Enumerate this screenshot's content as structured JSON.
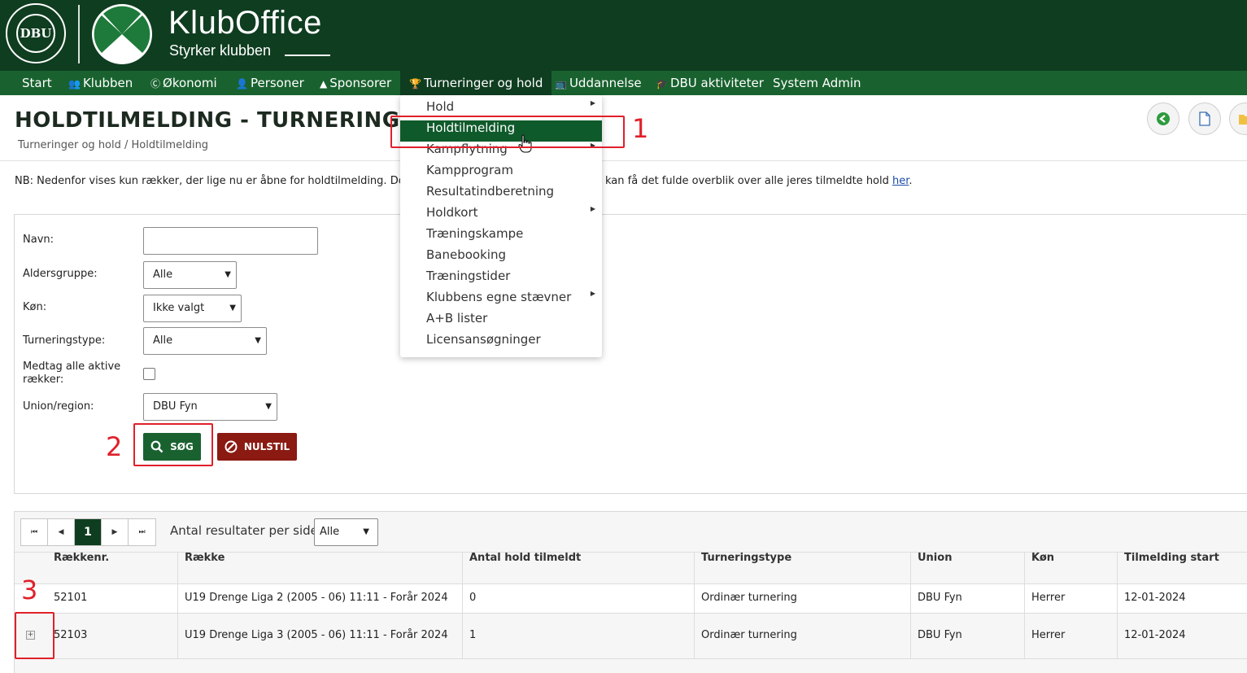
{
  "brand": {
    "logo_text": "DBU",
    "title": "KlubOffice",
    "subtitle": "Styrker klubben"
  },
  "nav": {
    "items": [
      {
        "label": "Start",
        "icon": "none"
      },
      {
        "label": "Klubben",
        "icon": "group-icon"
      },
      {
        "label": "Økonomi",
        "icon": "coin-icon"
      },
      {
        "label": "Personer",
        "icon": "person-icon"
      },
      {
        "label": "Sponsorer",
        "icon": "sponsor-icon"
      },
      {
        "label": "Turneringer og hold",
        "icon": "trophy-icon",
        "active": true
      },
      {
        "label": "Uddannelse",
        "icon": "presentation-icon"
      },
      {
        "label": "DBU aktiviteter",
        "icon": "graduation-cap-icon"
      },
      {
        "label": "System Admin",
        "icon": "none"
      }
    ]
  },
  "page": {
    "title": "HOLDTILMELDING - TURNERINGER OG",
    "breadcrumb": "Turneringer og hold / Holdtilmelding",
    "notice_start": "NB: Nedenfor vises kun rækker, der lige nu er åbne for holdtilmelding. Dobbeltkli",
    "notice_end": "kan få det fulde overblik over alle jeres tilmeldte hold ",
    "notice_link": "her",
    "notice_after": "."
  },
  "form": {
    "name_label": "Navn:",
    "name_value": "",
    "age_label": "Aldersgruppe:",
    "age_value": "Alle",
    "gender_label": "Køn:",
    "gender_value": "Ikke valgt",
    "type_label": "Turneringstype:",
    "type_value": "Alle",
    "include_label": "Medtag alle aktive rækker:",
    "include_checked": false,
    "union_label": "Union/region:",
    "union_value": "DBU Fyn",
    "search_button": "SØG",
    "reset_button": "NULSTIL"
  },
  "pager": {
    "current_page": "1",
    "per_page_label": "Antal resultater per side",
    "per_page_value": "Alle"
  },
  "table": {
    "columns": [
      "Rækkenr.",
      "Række",
      "Antal hold tilmeldt",
      "Turneringstype",
      "Union",
      "Køn",
      "Tilmelding start"
    ],
    "rows": [
      [
        "52101",
        "U19 Drenge Liga 2 (2005 - 06) 11:11 - Forår 2024",
        "0",
        "Ordinær turnering",
        "DBU Fyn",
        "Herrer",
        "12-01-2024"
      ],
      [
        "52103",
        "U19 Drenge Liga 3 (2005 - 06) 11:11 - Forår 2024",
        "1",
        "Ordinær turnering",
        "DBU Fyn",
        "Herrer",
        "12-01-2024"
      ]
    ]
  },
  "menu": {
    "items": [
      {
        "label": "Hold",
        "has_sub": true
      },
      {
        "label": "Holdtilmelding",
        "has_sub": false,
        "active": true
      },
      {
        "label": "Kampflytning",
        "has_sub": true
      },
      {
        "label": "Kampprogram",
        "has_sub": false
      },
      {
        "label": "Resultatindberetning",
        "has_sub": false
      },
      {
        "label": "Holdkort",
        "has_sub": true
      },
      {
        "label": "Træningskampe",
        "has_sub": false
      },
      {
        "label": "Banebooking",
        "has_sub": false
      },
      {
        "label": "Træningstider",
        "has_sub": false
      },
      {
        "label": "Klubbens egne stævner",
        "has_sub": true
      },
      {
        "label": "A+B lister",
        "has_sub": false
      },
      {
        "label": "Licensansøgninger",
        "has_sub": false
      }
    ]
  },
  "annotations": [
    "1",
    "2",
    "3"
  ],
  "colors": {
    "header": "#0f3d20",
    "nav": "#19622f",
    "search": "#19622f",
    "reset": "#8b1a12",
    "annotation": "#e0202a"
  }
}
